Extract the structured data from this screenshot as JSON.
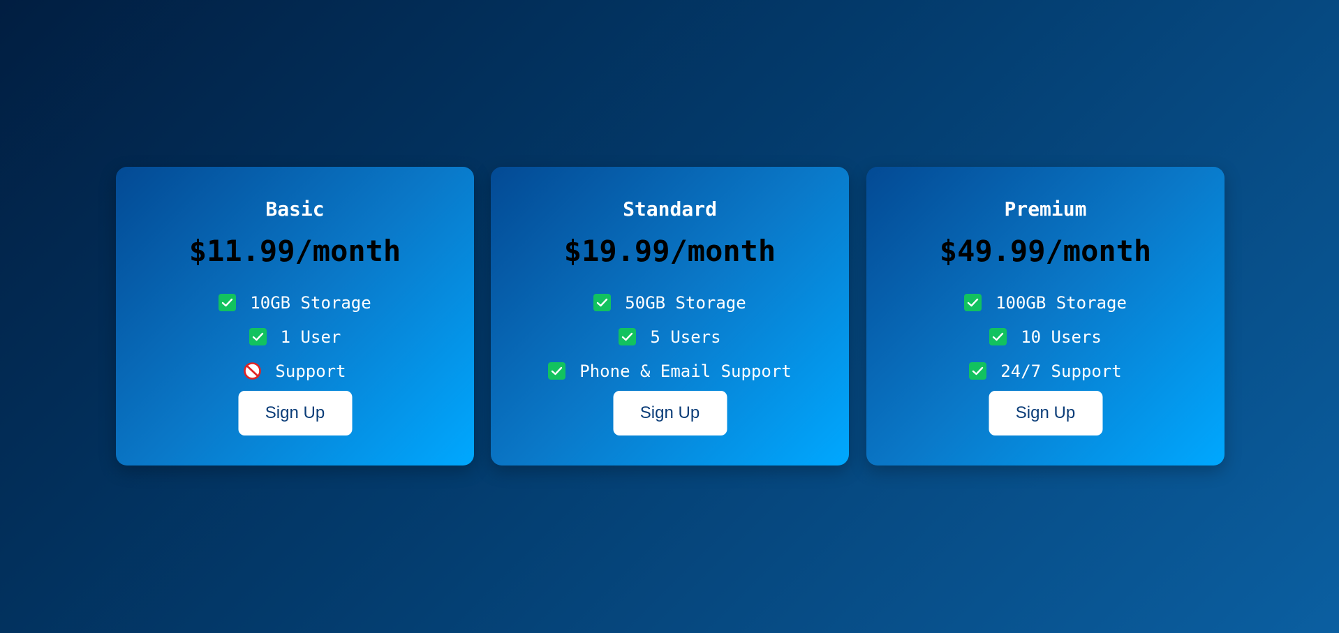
{
  "colors": {
    "accent_check": "#12c25f",
    "no_entry": "#e02424",
    "button_text": "#0b3d78",
    "price_text": "#000000"
  },
  "plans": [
    {
      "name": "Basic",
      "price": "$11.99/month",
      "features": [
        {
          "icon": "check-icon",
          "text": "10GB Storage"
        },
        {
          "icon": "check-icon",
          "text": "1 User"
        },
        {
          "icon": "no-entry-icon",
          "text": "Support"
        }
      ],
      "button_label": "Sign Up"
    },
    {
      "name": "Standard",
      "price": "$19.99/month",
      "features": [
        {
          "icon": "check-icon",
          "text": "50GB Storage"
        },
        {
          "icon": "check-icon",
          "text": "5 Users"
        },
        {
          "icon": "check-icon",
          "text": "Phone & Email Support"
        }
      ],
      "button_label": "Sign Up"
    },
    {
      "name": "Premium",
      "price": "$49.99/month",
      "features": [
        {
          "icon": "check-icon",
          "text": "100GB Storage"
        },
        {
          "icon": "check-icon",
          "text": "10 Users"
        },
        {
          "icon": "check-icon",
          "text": "24/7 Support"
        }
      ],
      "button_label": "Sign Up"
    }
  ]
}
